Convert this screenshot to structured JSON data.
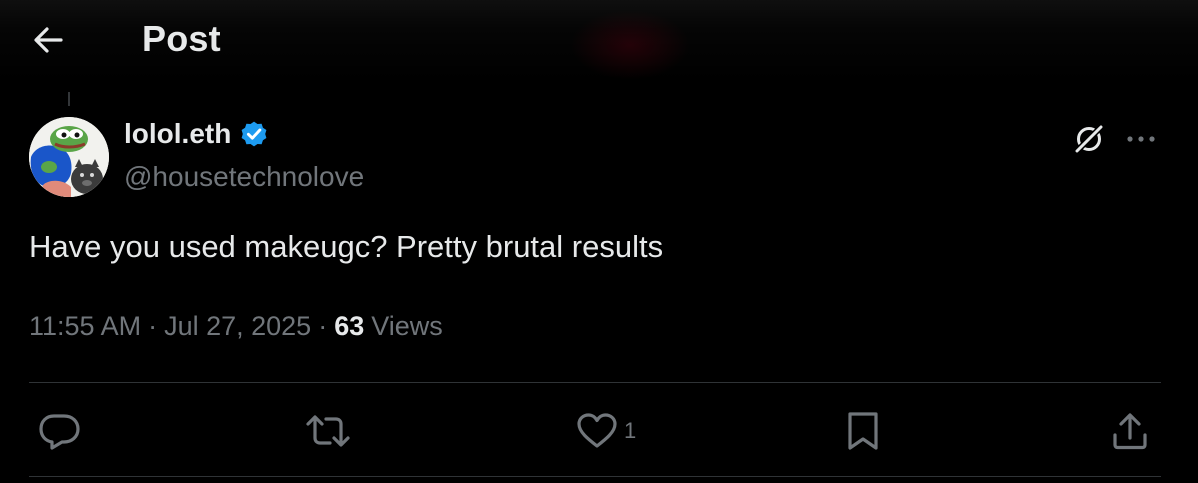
{
  "header": {
    "title": "Post",
    "back_icon": "arrow-left-icon"
  },
  "post": {
    "author": {
      "display_name": "lolol.eth",
      "handle": "@housetechnolove",
      "verified": true,
      "verified_color": "#1d9bf0"
    },
    "text": "Have you used makeugc? Pretty brutal results",
    "time": "11:55 AM",
    "date": "Jul 27, 2025",
    "views_count": "63",
    "views_label": "Views",
    "separator": "·"
  },
  "actions": {
    "reply": {
      "icon": "reply-icon"
    },
    "repost": {
      "icon": "repost-icon"
    },
    "like": {
      "icon": "heart-icon",
      "count": "1"
    },
    "bookmark": {
      "icon": "bookmark-icon"
    },
    "share": {
      "icon": "share-icon"
    }
  },
  "top_right": {
    "grok_icon": "grok-icon",
    "more_icon": "more-horizontal-icon"
  },
  "colors": {
    "background": "#000000",
    "text_primary": "#e7e9ea",
    "text_secondary": "#71767b",
    "divider": "#2f3336",
    "accent": "#1d9bf0"
  }
}
